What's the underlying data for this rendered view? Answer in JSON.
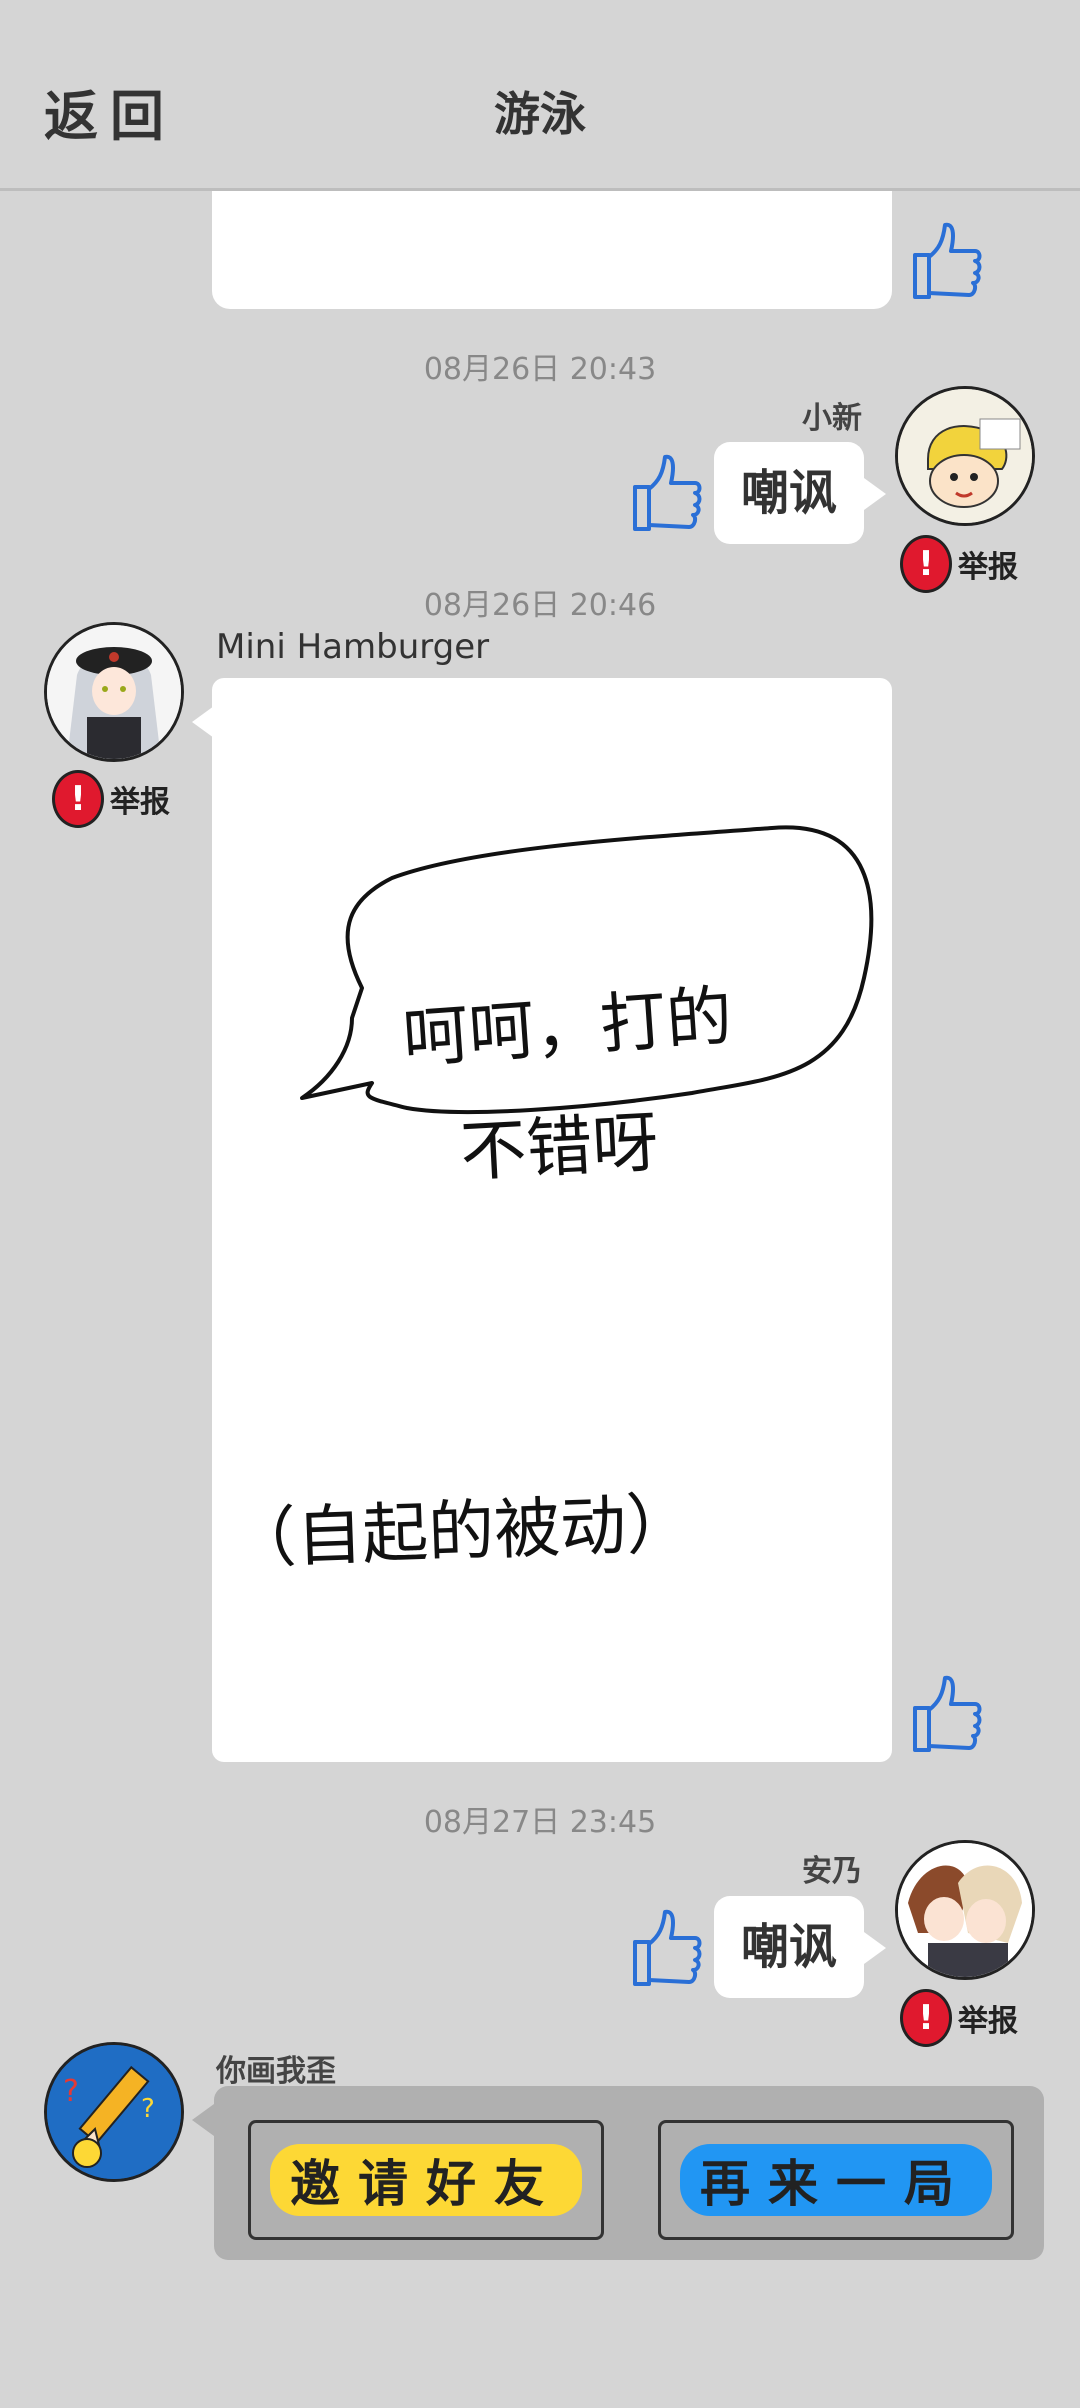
{
  "header": {
    "back_label": "返回",
    "title": "游泳"
  },
  "messages": [
    {
      "time": "08月26日  20:43",
      "sender": "小新",
      "text": "嘲讽",
      "report_label": "举报"
    },
    {
      "time": "08月26日  20:46",
      "sender": "Mini Hamburger",
      "report_label": "举报",
      "drawing_text_line1": "呵呵，打的",
      "drawing_text_line2": "不错呀",
      "drawing_text_line3": "（自起的被动）"
    },
    {
      "time": "08月27日  23:45",
      "sender": "安乃",
      "text": "嘲讽",
      "report_label": "举报"
    }
  ],
  "game_card": {
    "sender": "你画我歪",
    "invite_label": "邀请好友",
    "again_label": "再来一局",
    "invite_color": "#fdd835",
    "again_color": "#2196f3"
  },
  "icons": {
    "like": "thumbs-up-icon",
    "report": "exclamation-icon"
  }
}
